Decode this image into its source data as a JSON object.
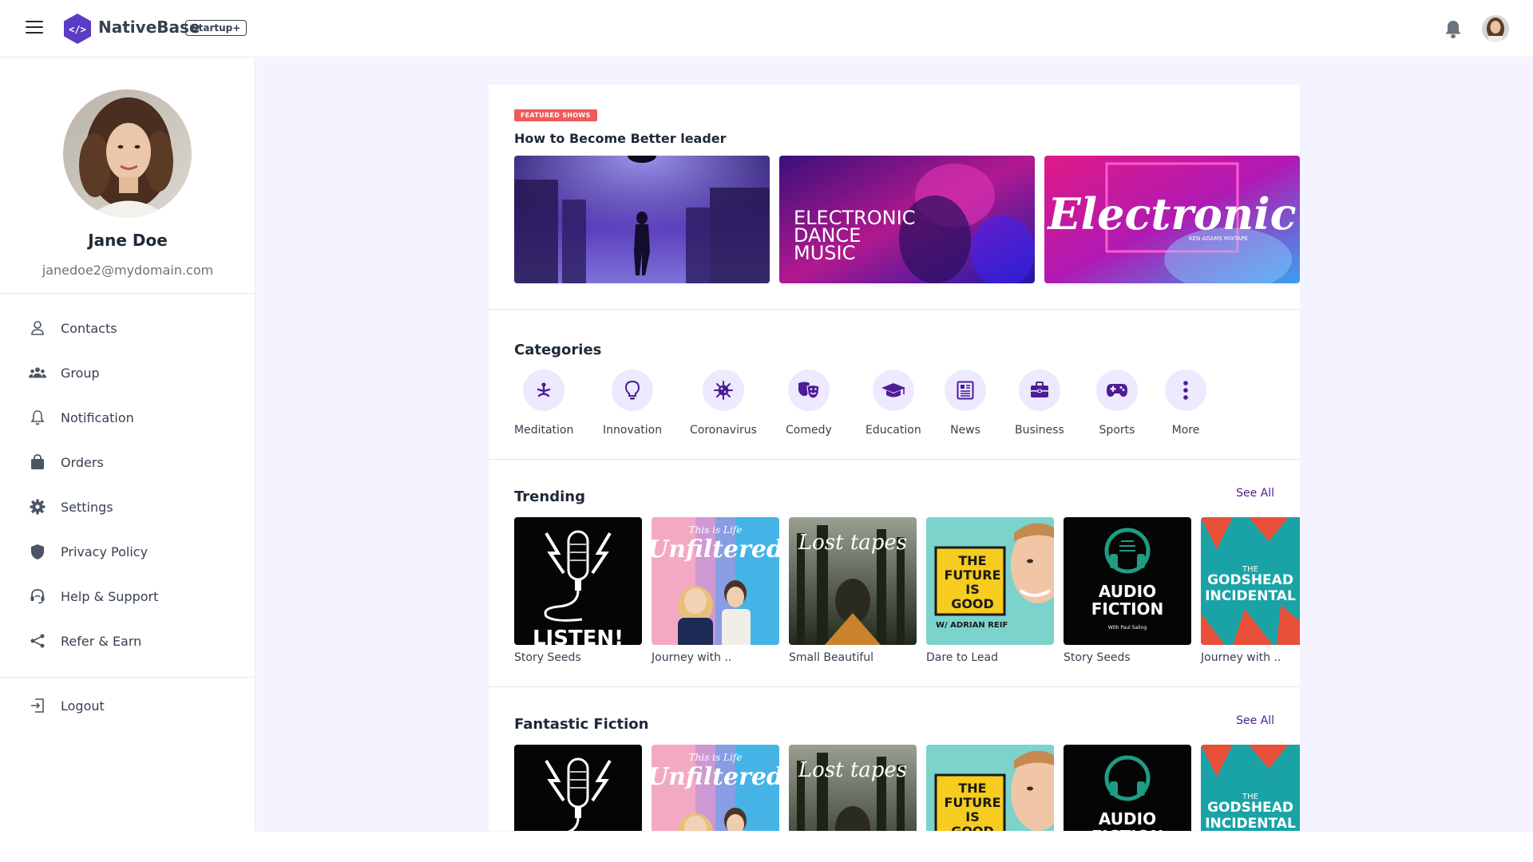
{
  "header": {
    "brand": "NativeBase",
    "plan_badge": "Startup+",
    "icons": [
      "menu-icon",
      "logo-icon",
      "bell-icon",
      "avatar"
    ]
  },
  "profile": {
    "name": "Jane Doe",
    "email": "janedoe2@mydomain.com"
  },
  "sidebar": {
    "items": [
      {
        "label": "Contacts",
        "icon": "person-icon"
      },
      {
        "label": "Group",
        "icon": "group-icon"
      },
      {
        "label": "Notification",
        "icon": "bell-icon"
      },
      {
        "label": "Orders",
        "icon": "shopping-bag-icon"
      },
      {
        "label": "Settings",
        "icon": "gear-icon"
      },
      {
        "label": "Privacy Policy",
        "icon": "shield-icon"
      },
      {
        "label": "Help & Support",
        "icon": "headset-icon"
      },
      {
        "label": "Refer & Earn",
        "icon": "share-icon"
      }
    ],
    "logout": {
      "label": "Logout",
      "icon": "logout-icon"
    }
  },
  "featured": {
    "tag": "FEATURED SHOWS",
    "title": "How to Become Better leader",
    "banners": [
      {
        "text": ""
      },
      {
        "text": "ELECTRONIC DANCE MUSIC"
      },
      {
        "text": "Electronic",
        "subtext": "KEN ADAMS MIXTAPE"
      }
    ]
  },
  "categories": {
    "title": "Categories",
    "items": [
      {
        "label": "Meditation",
        "icon": "meditation-icon"
      },
      {
        "label": "Innovation",
        "icon": "lightbulb-icon"
      },
      {
        "label": "Coronavirus",
        "icon": "virus-icon"
      },
      {
        "label": "Comedy",
        "icon": "comedy-mask-icon"
      },
      {
        "label": "Education",
        "icon": "graduation-cap-icon"
      },
      {
        "label": "News",
        "icon": "newspaper-icon"
      },
      {
        "label": "Business",
        "icon": "briefcase-icon"
      },
      {
        "label": "Sports",
        "icon": "gamepad-icon"
      },
      {
        "label": "More",
        "icon": "more-vertical-icon"
      }
    ]
  },
  "trending": {
    "title": "Trending",
    "see_all": "See All",
    "items": [
      {
        "label": "Story Seeds",
        "art": "LISTEN!"
      },
      {
        "label": "Journey with ..",
        "art": "Unfiltered",
        "art_top": "This is Life"
      },
      {
        "label": "Small Beautiful",
        "art": "Lost tapes"
      },
      {
        "label": "Dare to Lead",
        "art": "THE FUTURE IS GOOD",
        "art_sub": "W/ ADRIAN REIF"
      },
      {
        "label": "Story Seeds",
        "art": "AUDIO FICTION",
        "art_sub": "With Paul Saling"
      },
      {
        "label": "Journey with ..",
        "art": "THE GODSHEAD INCIDENTAL"
      }
    ]
  },
  "fiction": {
    "title": "Fantastic Fiction",
    "see_all": "See All",
    "items": [
      {
        "art": ""
      },
      {
        "art": "Unfiltered",
        "art_top": "This is Life"
      },
      {
        "art": "Lost tapes"
      },
      {
        "art": "THE FUTURE IS GOOD"
      },
      {
        "art": "AUDIO FICTION"
      },
      {
        "art": "THE GODSHEAD INCIDENTAL"
      }
    ]
  },
  "colors": {
    "accent": "#5b3cc4",
    "category_bg": "#ede9fe",
    "tag": "#f05a5a",
    "page_bg": "#f5f3ff"
  }
}
